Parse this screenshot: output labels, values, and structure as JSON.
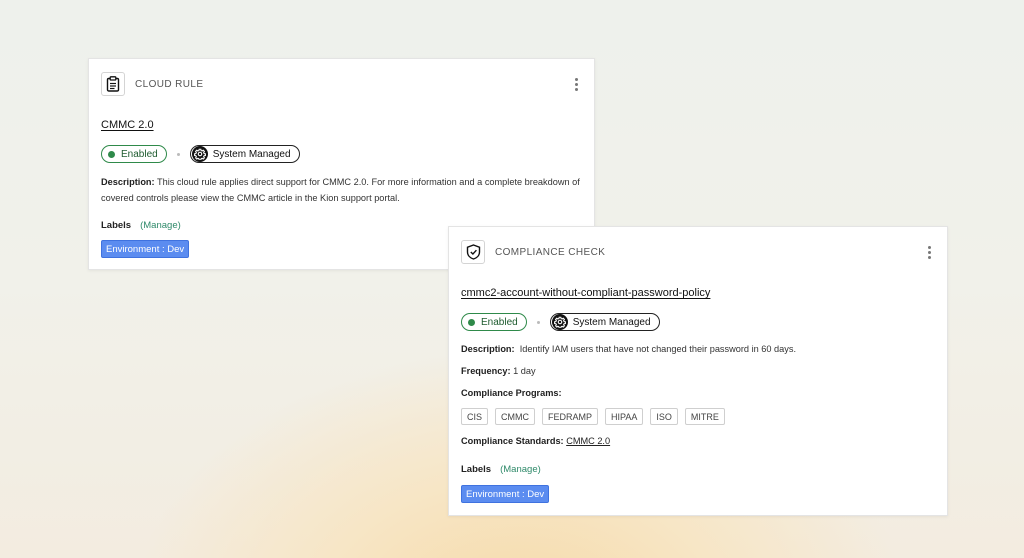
{
  "cloud_rule": {
    "kind": "CLOUD RULE",
    "title": "CMMC 2.0",
    "status": "Enabled",
    "managed": "System Managed",
    "description_label": "Description:",
    "description": "This cloud rule applies direct support for CMMC 2.0. For more information and a complete breakdown of covered controls please view the CMMC article in the Kion support portal.",
    "labels_label": "Labels",
    "manage_link": "(Manage)",
    "tag": "Environment : Dev"
  },
  "compliance_check": {
    "kind": "COMPLIANCE CHECK",
    "title": "cmmc2-account-without-compliant-password-policy",
    "status": "Enabled",
    "managed": "System Managed",
    "description_label": "Description:",
    "description": "Identify IAM users that have not changed their password in 60 days.",
    "frequency_label": "Frequency:",
    "frequency": "1 day",
    "programs_label": "Compliance Programs:",
    "programs": [
      "CIS",
      "CMMC",
      "FEDRAMP",
      "HIPAA",
      "ISO",
      "MITRE"
    ],
    "standards_label": "Compliance Standards:",
    "standards": "CMMC 2.0",
    "labels_label": "Labels",
    "manage_link": "(Manage)",
    "tag": "Environment : Dev"
  },
  "colors": {
    "enabled_green": "#2f8a4a",
    "tag_blue": "#5b8cf0",
    "manage_link": "#2f8a6a"
  },
  "icons": {
    "cloud_rule": "clipboard-icon",
    "compliance_check": "shield-check-icon",
    "managed": "gear-icon",
    "menu": "kebab-menu-icon"
  }
}
